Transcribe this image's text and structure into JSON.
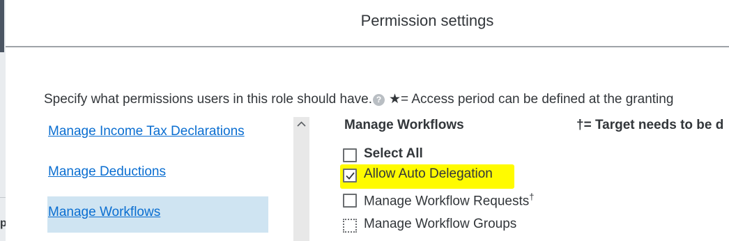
{
  "background": {
    "letter": "p"
  },
  "dialog": {
    "title": "Permission settings",
    "intro_text": "Specify what permissions users in this role should have.",
    "help_icon": "question-mark-icon",
    "access_note": "★= Access period can be defined at the granting"
  },
  "categories": [
    {
      "label": "Manage Income Tax Declarations",
      "selected": false
    },
    {
      "label": "Manage Deductions",
      "selected": false
    },
    {
      "label": "Manage Workflows",
      "selected": true
    }
  ],
  "section": {
    "title": "Manage Workflows",
    "target_note": "†= Target needs to be d"
  },
  "permissions": {
    "select_all": {
      "label": "Select All",
      "checked": false
    },
    "items": [
      {
        "label": "Allow Auto Delegation",
        "checked": true,
        "highlighted": true
      },
      {
        "label": "Manage Workflow Requests",
        "dagger": "†",
        "checked": false
      },
      {
        "label": "Manage Workflow Groups",
        "checked": false,
        "focused": true
      }
    ]
  },
  "colors": {
    "link": "#0a6ed1",
    "selected_bg": "#cfe4f2",
    "highlight": "#fffb00"
  }
}
